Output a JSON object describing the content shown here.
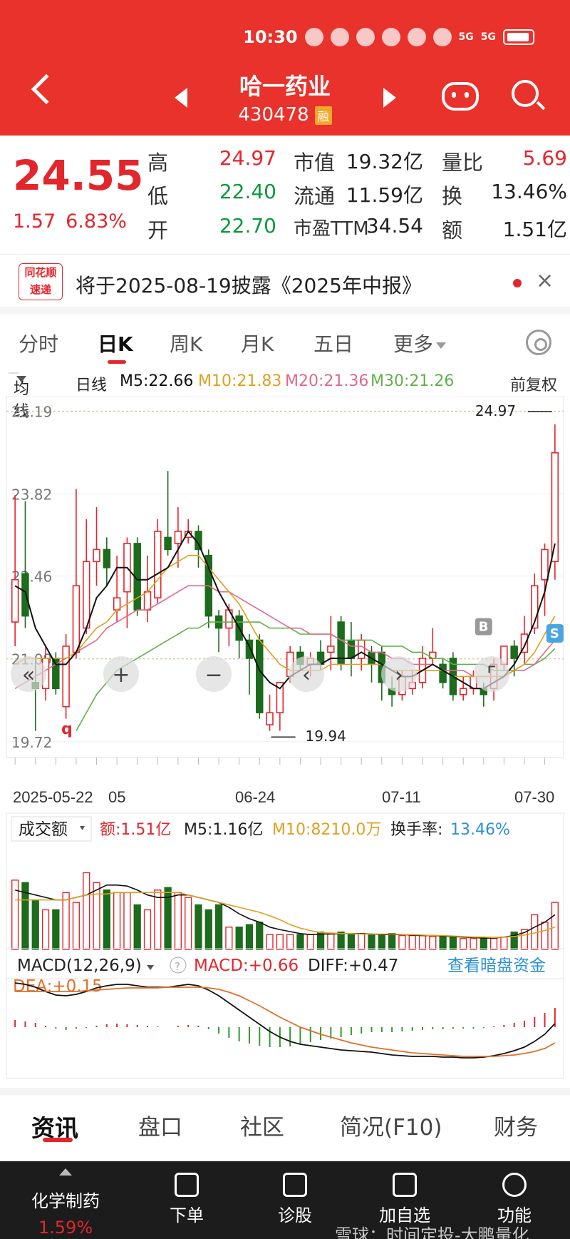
{
  "status": {
    "time": "10:30",
    "net1": "5G",
    "net2": "5G"
  },
  "header": {
    "name": "哈一药业",
    "code": "430478",
    "badge": "融"
  },
  "quote": {
    "price": "24.55",
    "change": "1.57",
    "pct": "6.83%",
    "high_label": "高",
    "high": "24.97",
    "low_label": "低",
    "low": "22.40",
    "open_label": "开",
    "open": "22.70",
    "mcap_label": "市值",
    "mcap": "19.32亿",
    "float_label": "流通",
    "float": "11.59亿",
    "pe_label": "市盈TTM",
    "pe": "34.54",
    "vr_label": "量比",
    "vr": "5.69",
    "turn_label": "换",
    "turn": "13.46%",
    "amt_label": "额",
    "amt": "1.51亿"
  },
  "notice": {
    "logo_top": "同花顺",
    "logo_bottom": "速递",
    "text": "将于2025-08-19披露《2025年中报》",
    "close": "×"
  },
  "period_tabs": [
    "分时",
    "日K",
    "周K",
    "月K",
    "五日",
    "更多"
  ],
  "ma": {
    "select": "均线",
    "kind": "日线",
    "m5": "M5:22.66",
    "m10": "M10:21.83",
    "m20": "M20:21.36",
    "m30": "M30:21.26",
    "adjust": "前复权"
  },
  "chart_data": {
    "type": "candlestick",
    "y_ticks": [
      "25.19",
      "23.82",
      "22.46",
      "21.09",
      "19.72"
    ],
    "x_ticks": [
      "2025-05-22",
      "05",
      "06-24",
      "07-11",
      "07-30"
    ],
    "high_mark": "24.97",
    "low_mark": "19.94",
    "left_mark": "q",
    "markers": [
      "B",
      "S"
    ],
    "colors": {
      "up": "#e3262c",
      "down": "#1d6b1d",
      "m5": "#111111",
      "m10": "#e0a020",
      "m20": "#e06a8a",
      "m30": "#5fb14a"
    },
    "candles": [
      {
        "o": 21.7,
        "c": 22.4,
        "h": 23.8,
        "l": 21.3
      },
      {
        "o": 22.5,
        "c": 21.8,
        "h": 23.7,
        "l": 21.6
      },
      {
        "o": 20.7,
        "c": 20.6,
        "h": 21.1,
        "l": 19.9
      },
      {
        "o": 20.6,
        "c": 21.1,
        "h": 21.3,
        "l": 20.4
      },
      {
        "o": 21.1,
        "c": 20.6,
        "h": 21.2,
        "l": 20.5
      },
      {
        "o": 20.3,
        "c": 21.3,
        "h": 21.5,
        "l": 20.1
      },
      {
        "o": 21.2,
        "c": 22.3,
        "h": 23.9,
        "l": 21.1
      },
      {
        "o": 21.6,
        "c": 22.7,
        "h": 23.4,
        "l": 21.5
      },
      {
        "o": 22.7,
        "c": 22.9,
        "h": 23.6,
        "l": 22.3
      },
      {
        "o": 22.9,
        "c": 22.6,
        "h": 23.1,
        "l": 22.3
      },
      {
        "o": 21.9,
        "c": 22.1,
        "h": 22.8,
        "l": 21.7
      },
      {
        "o": 22.2,
        "c": 23.0,
        "h": 23.1,
        "l": 21.6
      },
      {
        "o": 23.0,
        "c": 21.9,
        "h": 23.1,
        "l": 21.8
      },
      {
        "o": 21.9,
        "c": 22.2,
        "h": 22.8,
        "l": 21.7
      },
      {
        "o": 22.1,
        "c": 23.2,
        "h": 23.4,
        "l": 22.0
      },
      {
        "o": 23.1,
        "c": 22.9,
        "h": 24.2,
        "l": 22.8
      },
      {
        "o": 23.0,
        "c": 23.2,
        "h": 23.6,
        "l": 22.6
      },
      {
        "o": 23.1,
        "c": 23.2,
        "h": 23.4,
        "l": 23.0
      },
      {
        "o": 23.2,
        "c": 22.9,
        "h": 23.3,
        "l": 22.6
      },
      {
        "o": 22.8,
        "c": 21.8,
        "h": 22.9,
        "l": 21.6
      },
      {
        "o": 21.8,
        "c": 21.6,
        "h": 21.9,
        "l": 21.2
      },
      {
        "o": 21.6,
        "c": 21.9,
        "h": 22.0,
        "l": 21.3
      },
      {
        "o": 21.8,
        "c": 21.4,
        "h": 21.9,
        "l": 21.1
      },
      {
        "o": 21.4,
        "c": 21.1,
        "h": 21.5,
        "l": 20.5
      },
      {
        "o": 21.4,
        "c": 20.2,
        "h": 21.5,
        "l": 20.1
      },
      {
        "o": 20.0,
        "c": 20.2,
        "h": 20.5,
        "l": 19.9
      },
      {
        "o": 20.2,
        "c": 20.7,
        "h": 20.7,
        "l": 19.9
      },
      {
        "o": 20.8,
        "c": 21.2,
        "h": 21.3,
        "l": 20.7
      },
      {
        "o": 21.2,
        "c": 21.0,
        "h": 21.3,
        "l": 20.9
      },
      {
        "o": 21.0,
        "c": 21.1,
        "h": 21.2,
        "l": 20.8
      },
      {
        "o": 21.2,
        "c": 21.0,
        "h": 21.4,
        "l": 20.9
      },
      {
        "o": 21.2,
        "c": 21.3,
        "h": 21.8,
        "l": 20.9
      },
      {
        "o": 21.7,
        "c": 21.0,
        "h": 21.8,
        "l": 20.9
      },
      {
        "o": 21.4,
        "c": 21.1,
        "h": 21.7,
        "l": 20.8
      },
      {
        "o": 21.1,
        "c": 21.4,
        "h": 21.5,
        "l": 20.9
      },
      {
        "o": 21.2,
        "c": 21.0,
        "h": 21.3,
        "l": 20.7
      },
      {
        "o": 21.2,
        "c": 20.7,
        "h": 21.3,
        "l": 20.4
      },
      {
        "o": 20.6,
        "c": 20.5,
        "h": 20.8,
        "l": 20.3
      },
      {
        "o": 20.5,
        "c": 20.8,
        "h": 20.9,
        "l": 20.4
      },
      {
        "o": 20.6,
        "c": 20.7,
        "h": 20.9,
        "l": 20.5
      },
      {
        "o": 20.7,
        "c": 21.1,
        "h": 21.3,
        "l": 20.6
      },
      {
        "o": 21.1,
        "c": 21.2,
        "h": 21.6,
        "l": 21.0
      },
      {
        "o": 21.0,
        "c": 20.7,
        "h": 21.1,
        "l": 20.6
      },
      {
        "o": 21.1,
        "c": 20.5,
        "h": 21.2,
        "l": 20.4
      },
      {
        "o": 20.5,
        "c": 20.6,
        "h": 20.8,
        "l": 20.4
      },
      {
        "o": 20.6,
        "c": 20.8,
        "h": 20.9,
        "l": 20.5
      },
      {
        "o": 20.6,
        "c": 20.5,
        "h": 20.7,
        "l": 20.3
      },
      {
        "o": 20.6,
        "c": 21.0,
        "h": 21.1,
        "l": 20.4
      },
      {
        "o": 21.0,
        "c": 21.3,
        "h": 21.3,
        "l": 20.9
      },
      {
        "o": 21.3,
        "c": 21.1,
        "h": 21.4,
        "l": 20.8
      },
      {
        "o": 21.2,
        "c": 21.5,
        "h": 21.8,
        "l": 21.0
      },
      {
        "o": 21.6,
        "c": 22.3,
        "h": 22.5,
        "l": 21.5
      },
      {
        "o": 22.4,
        "c": 22.9,
        "h": 23.0,
        "l": 21.8
      },
      {
        "o": 22.7,
        "c": 24.5,
        "h": 24.97,
        "l": 22.4
      }
    ],
    "ma5": [
      22.3,
      22.2,
      21.6,
      21.3,
      21.0,
      21.0,
      21.2,
      21.6,
      22.1,
      22.3,
      22.6,
      22.6,
      22.4,
      22.4,
      22.5,
      22.6,
      22.9,
      23.2,
      23.0,
      22.6,
      22.2,
      21.9,
      21.6,
      21.3,
      20.9,
      20.7,
      20.6,
      20.8,
      20.9,
      21.0,
      21.0,
      21.1,
      21.1,
      21.1,
      21.2,
      21.1,
      21.0,
      20.9,
      20.8,
      20.8,
      20.9,
      21.0,
      20.9,
      20.8,
      20.7,
      20.6,
      20.6,
      20.7,
      20.8,
      21.0,
      21.3,
      21.7,
      22.2,
      23.0
    ],
    "ma10": [
      21.0,
      21.1,
      21.1,
      21.1,
      21.1,
      21.1,
      21.2,
      21.4,
      21.6,
      21.7,
      21.9,
      22.0,
      22.1,
      22.2,
      22.4,
      22.6,
      22.7,
      22.8,
      22.8,
      22.6,
      22.4,
      22.2,
      22.0,
      21.7,
      21.4,
      21.2,
      21.0,
      20.9,
      20.9,
      20.9,
      20.9,
      21.0,
      21.0,
      21.0,
      21.0,
      21.0,
      21.0,
      20.9,
      20.9,
      20.9,
      20.9,
      20.9,
      20.9,
      20.8,
      20.8,
      20.8,
      20.8,
      20.8,
      20.8,
      20.9,
      21.0,
      21.2,
      21.5,
      21.8
    ],
    "ma20": [
      20.6,
      20.7,
      20.8,
      20.9,
      21.0,
      21.1,
      21.2,
      21.3,
      21.4,
      21.6,
      21.7,
      21.8,
      21.9,
      21.9,
      22.0,
      22.1,
      22.2,
      22.3,
      22.3,
      22.3,
      22.2,
      22.2,
      22.1,
      22.0,
      21.9,
      21.8,
      21.7,
      21.6,
      21.6,
      21.5,
      21.5,
      21.5,
      21.4,
      21.3,
      21.3,
      21.2,
      21.2,
      21.1,
      21.1,
      21.0,
      21.0,
      21.0,
      20.9,
      20.9,
      20.9,
      20.8,
      20.8,
      20.8,
      20.8,
      20.9,
      20.9,
      21.0,
      21.2,
      21.4
    ],
    "ma30": [
      null,
      null,
      null,
      null,
      null,
      null,
      19.9,
      20.2,
      20.5,
      20.7,
      20.9,
      21.0,
      21.1,
      21.2,
      21.3,
      21.4,
      21.5,
      21.6,
      21.6,
      21.7,
      21.7,
      21.7,
      21.7,
      21.7,
      21.7,
      21.6,
      21.6,
      21.6,
      21.5,
      21.5,
      21.5,
      21.5,
      21.4,
      21.4,
      21.4,
      21.4,
      21.3,
      21.3,
      21.3,
      21.2,
      21.2,
      21.1,
      21.1,
      21.0,
      21.0,
      21.0,
      21.0,
      20.9,
      20.9,
      20.9,
      21.0,
      21.0,
      21.1,
      21.26
    ],
    "volume": {
      "select": "成交额",
      "amt": "额:1.51亿",
      "m5": "M5:1.16亿",
      "m10": "M10:8210.0万",
      "turn_label": "换手率:",
      "turn": "13.46%",
      "values": [
        1.4,
        1.35,
        1.0,
        0.8,
        0.8,
        1.15,
        0.95,
        1.55,
        1.35,
        1.2,
        1.15,
        1.15,
        0.9,
        0.8,
        1.2,
        1.25,
        1.15,
        1.05,
        0.9,
        0.8,
        0.9,
        0.45,
        0.45,
        0.5,
        0.55,
        0.3,
        0.3,
        0.3,
        0.3,
        0.3,
        0.35,
        0.32,
        0.35,
        0.3,
        0.32,
        0.3,
        0.3,
        0.32,
        0.28,
        0.28,
        0.28,
        0.26,
        0.28,
        0.26,
        0.22,
        0.22,
        0.24,
        0.22,
        0.25,
        0.35,
        0.4,
        0.7,
        0.55,
        0.95,
        0.9
      ],
      "m5_line": [
        1.2,
        1.15,
        1.1,
        1.05,
        1.0,
        1.0,
        1.05,
        1.1,
        1.2,
        1.3,
        1.3,
        1.28,
        1.2,
        1.1,
        1.05,
        1.05,
        1.1,
        1.1,
        1.05,
        1.0,
        0.95,
        0.85,
        0.72,
        0.62,
        0.55,
        0.45,
        0.4,
        0.36,
        0.32,
        0.3,
        0.31,
        0.31,
        0.32,
        0.32,
        0.32,
        0.31,
        0.3,
        0.3,
        0.3,
        0.29,
        0.28,
        0.28,
        0.27,
        0.26,
        0.25,
        0.24,
        0.23,
        0.23,
        0.25,
        0.28,
        0.34,
        0.45,
        0.55,
        0.7,
        0.85
      ],
      "m10_line": [
        1.0,
        1.0,
        1.0,
        1.0,
        1.0,
        1.0,
        1.05,
        1.1,
        1.12,
        1.12,
        1.15,
        1.15,
        1.15,
        1.15,
        1.15,
        1.15,
        1.15,
        1.1,
        1.05,
        1.0,
        0.95,
        0.9,
        0.85,
        0.8,
        0.75,
        0.68,
        0.6,
        0.5,
        0.43,
        0.38,
        0.34,
        0.33,
        0.32,
        0.32,
        0.31,
        0.31,
        0.31,
        0.31,
        0.3,
        0.3,
        0.29,
        0.28,
        0.28,
        0.27,
        0.26,
        0.25,
        0.25,
        0.24,
        0.25,
        0.26,
        0.29,
        0.33,
        0.38,
        0.45,
        0.55
      ]
    },
    "macd": {
      "title": "MACD(12,26,9)",
      "macd": "MACD:+0.66",
      "diff": "DIFF:+0.47",
      "dea": "DEA:+0.15",
      "link": "查看暗盘资金",
      "diff_line": [
        0.62,
        0.6,
        0.56,
        0.5,
        0.45,
        0.44,
        0.46,
        0.5,
        0.55,
        0.58,
        0.6,
        0.6,
        0.58,
        0.56,
        0.56,
        0.56,
        0.58,
        0.6,
        0.58,
        0.52,
        0.44,
        0.34,
        0.24,
        0.14,
        0.04,
        -0.06,
        -0.14,
        -0.2,
        -0.24,
        -0.26,
        -0.28,
        -0.3,
        -0.32,
        -0.33,
        -0.34,
        -0.35,
        -0.37,
        -0.39,
        -0.4,
        -0.41,
        -0.41,
        -0.41,
        -0.42,
        -0.42,
        -0.43,
        -0.43,
        -0.42,
        -0.4,
        -0.37,
        -0.33,
        -0.28,
        -0.2,
        -0.1,
        0.05,
        0.2,
        0.47
      ],
      "dea_line": [
        0.5,
        0.5,
        0.5,
        0.5,
        0.5,
        0.5,
        0.5,
        0.51,
        0.52,
        0.53,
        0.54,
        0.55,
        0.55,
        0.55,
        0.55,
        0.56,
        0.56,
        0.56,
        0.56,
        0.55,
        0.53,
        0.49,
        0.44,
        0.37,
        0.3,
        0.22,
        0.14,
        0.07,
        0.0,
        -0.05,
        -0.1,
        -0.14,
        -0.18,
        -0.22,
        -0.25,
        -0.28,
        -0.3,
        -0.32,
        -0.34,
        -0.36,
        -0.37,
        -0.38,
        -0.39,
        -0.4,
        -0.41,
        -0.41,
        -0.41,
        -0.41,
        -0.4,
        -0.39,
        -0.37,
        -0.34,
        -0.3,
        -0.22,
        -0.1,
        0.15
      ],
      "hist": [
        0.1,
        0.08,
        0.06,
        0.02,
        -0.02,
        -0.04,
        -0.02,
        -0.01,
        0.02,
        0.04,
        0.05,
        0.04,
        0.03,
        0.02,
        0.01,
        0.0,
        0.02,
        0.03,
        0.02,
        -0.03,
        -0.09,
        -0.15,
        -0.2,
        -0.23,
        -0.26,
        -0.28,
        -0.28,
        -0.27,
        -0.24,
        -0.21,
        -0.18,
        -0.16,
        -0.14,
        -0.11,
        -0.09,
        -0.07,
        -0.07,
        -0.07,
        -0.06,
        -0.05,
        -0.04,
        -0.03,
        -0.03,
        -0.02,
        -0.02,
        -0.02,
        -0.01,
        0.01,
        0.03,
        0.06,
        0.09,
        0.14,
        0.2,
        0.27,
        0.3,
        0.64
      ]
    }
  },
  "bottom_tabs": [
    "资讯",
    "盘口",
    "社区",
    "简况(F10)",
    "财务"
  ],
  "bottom_nav": {
    "sector_name": "化学制药",
    "sector_pct": "1.59%",
    "items": [
      "下单",
      "诊股",
      "加自选",
      "功能"
    ],
    "watermark": "雪球：时间定投-大鹏量化"
  }
}
